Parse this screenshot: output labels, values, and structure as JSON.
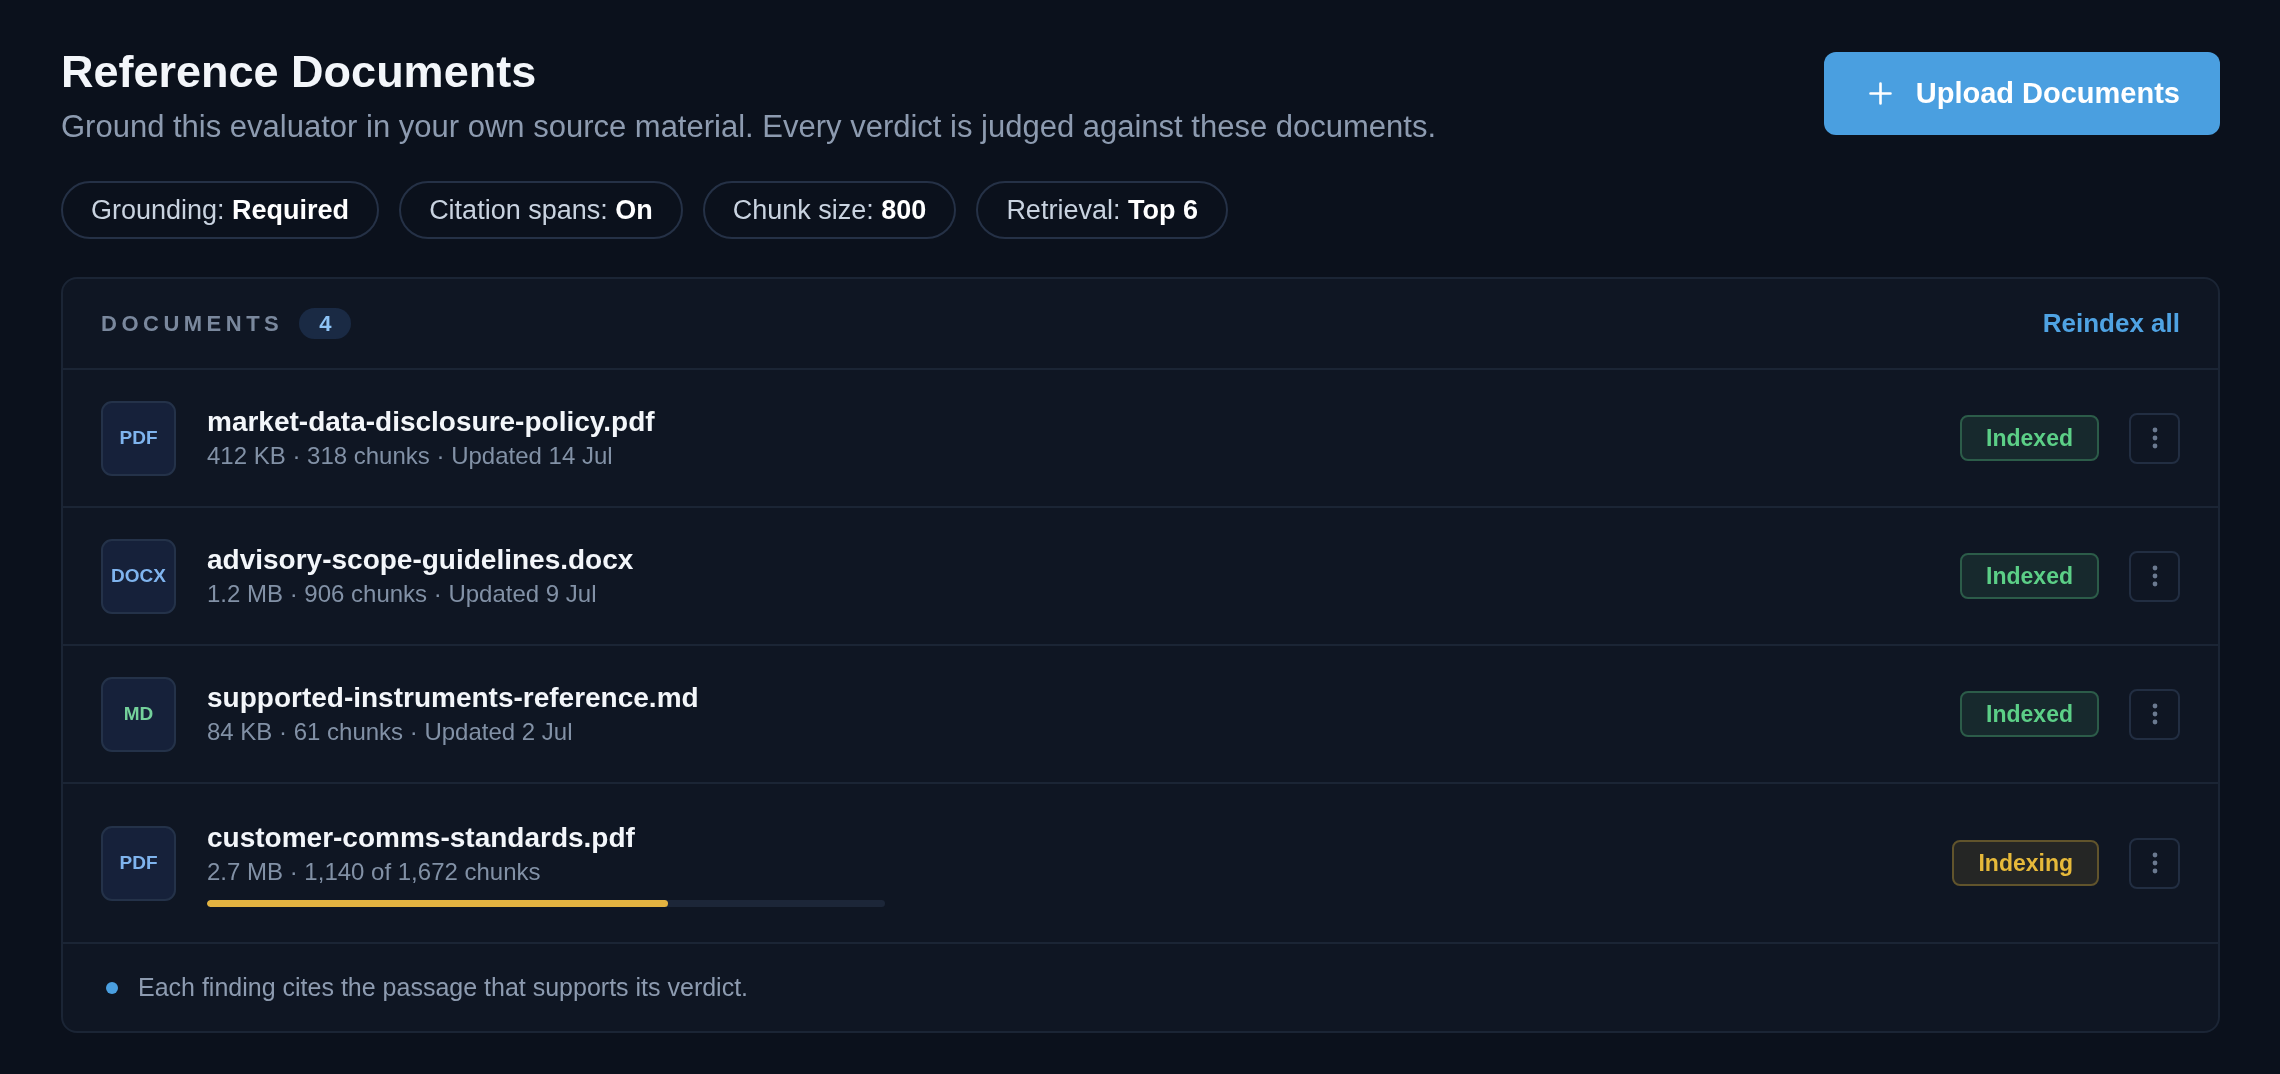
{
  "header": {
    "title": "Reference Documents",
    "subtitle": "Ground this evaluator in your own source material. Every verdict is judged against these documents.",
    "upload_button": "Upload Documents"
  },
  "settings": [
    "Grounding: **Required**",
    "Citation spans: **On**",
    "Chunk size: **800**",
    "Retrieval: **Top 6**"
  ],
  "documents": {
    "label": "DOCUMENTS",
    "count": "4",
    "action": "Reindex all",
    "rows": [
      {
        "type": "PDF",
        "color": "#7fb4ee",
        "name": "market-data-disclosure-policy.pdf",
        "meta": "412 KB · 318 chunks · Updated 14 Jul",
        "status": {
          "label": "Indexed",
          "color": "#5ccf87"
        }
      },
      {
        "type": "DOCX",
        "color": "#7fb4ee",
        "name": "advisory-scope-guidelines.docx",
        "meta": "1.2 MB · 906 chunks · Updated 9 Jul",
        "status": {
          "label": "Indexed",
          "color": "#5ccf87"
        }
      },
      {
        "type": "MD",
        "color": "#74d19b",
        "name": "supported-instruments-reference.md",
        "meta": "84 KB · 61 chunks · Updated 2 Jul",
        "status": {
          "label": "Indexed",
          "color": "#5ccf87"
        }
      },
      {
        "type": "PDF",
        "color": "#7fb4ee",
        "name": "customer-comms-standards.pdf",
        "meta": "2.7 MB · 1,140 of 1,672 chunks",
        "progress": {
          "level": 0.68
        },
        "status": {
          "label": "Indexing",
          "color": "#e6b93a"
        }
      }
    ]
  },
  "footer_note": "Each finding cites the passage that supports its verdict."
}
